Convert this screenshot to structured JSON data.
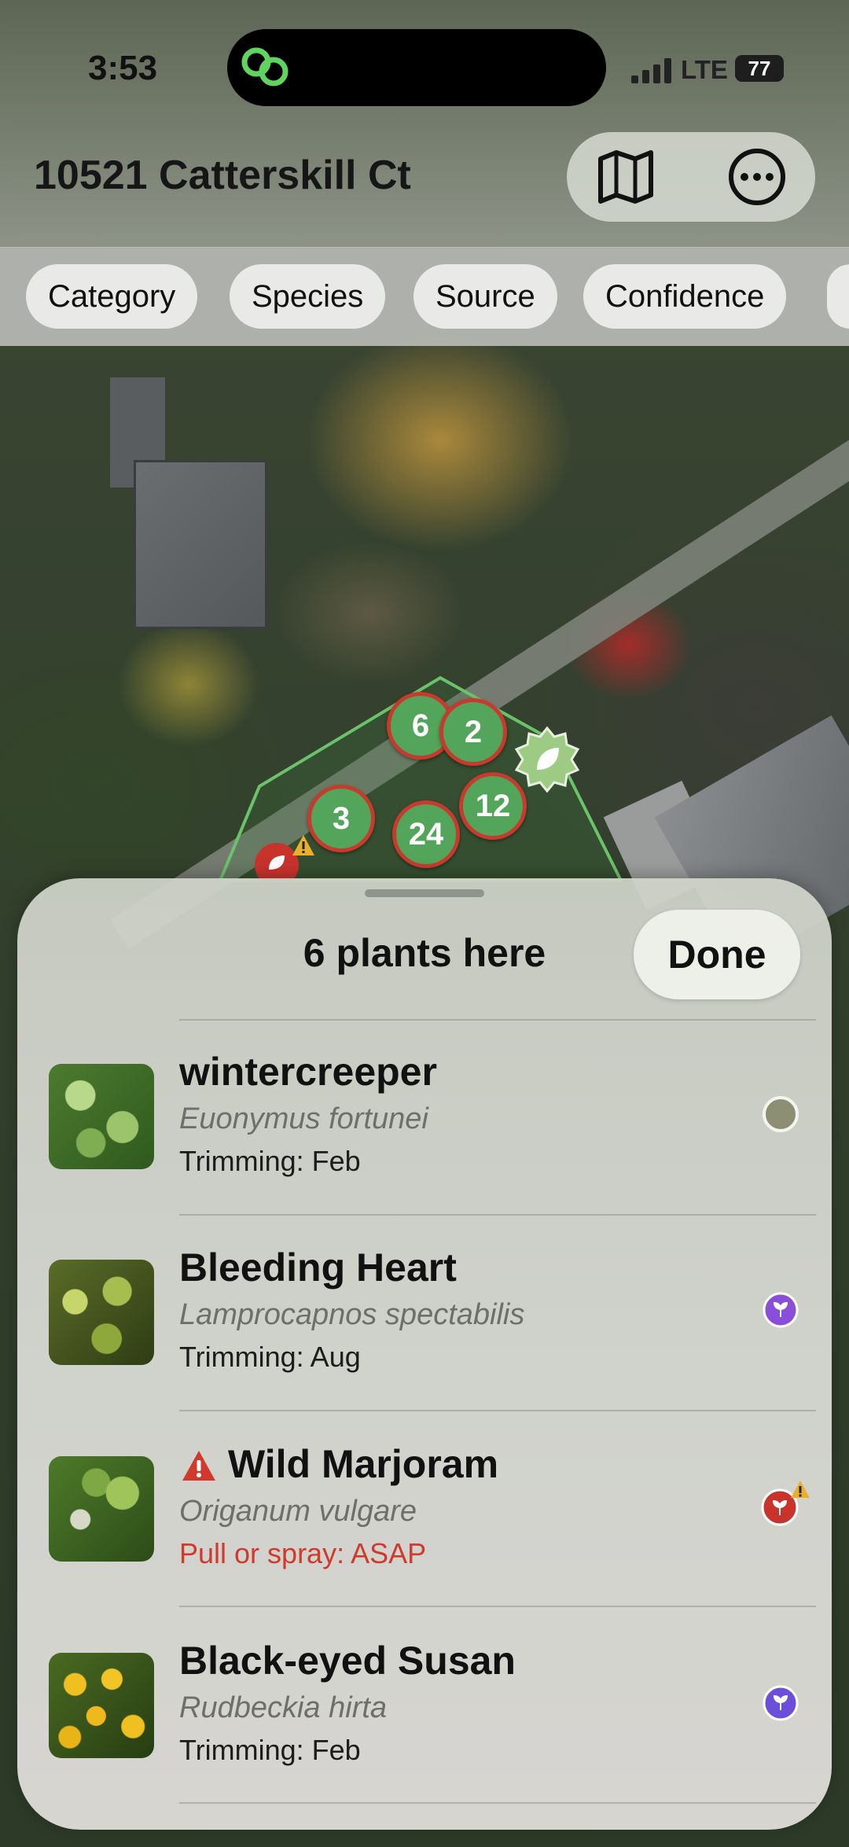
{
  "status_bar": {
    "time": "3:53",
    "network": "LTE",
    "battery": "77"
  },
  "header": {
    "title": "10521 Catterskill Ct",
    "map_icon": "map-icon",
    "more_icon": "ellipsis-circle-icon"
  },
  "filters": [
    "Category",
    "Species",
    "Source",
    "Confidence"
  ],
  "map_markers": [
    "6",
    "2",
    "12",
    "3",
    "24"
  ],
  "sheet": {
    "title": "6 plants here",
    "done_label": "Done",
    "plants": [
      {
        "name": "wintercreeper",
        "scientific": "Euonymus fortunei",
        "detail": "Trimming: Feb",
        "status": "ring",
        "alert": false
      },
      {
        "name": "Bleeding Heart",
        "scientific": "Lamprocapnos spectabilis",
        "detail": "Trimming: Aug",
        "status": "purple",
        "alert": false
      },
      {
        "name": "Wild Marjoram",
        "scientific": "Origanum vulgare",
        "detail": "Pull or spray: ASAP",
        "status": "red-warning",
        "alert": true
      },
      {
        "name": "Black-eyed Susan",
        "scientific": "Rudbeckia hirta",
        "detail": "Trimming: Feb",
        "status": "purple",
        "alert": false
      }
    ]
  },
  "colors": {
    "marker_fill": "#52a55a",
    "marker_ring": "#c83a2e",
    "alert": "#d03a2c",
    "purple_status": "#8a4fd8"
  }
}
